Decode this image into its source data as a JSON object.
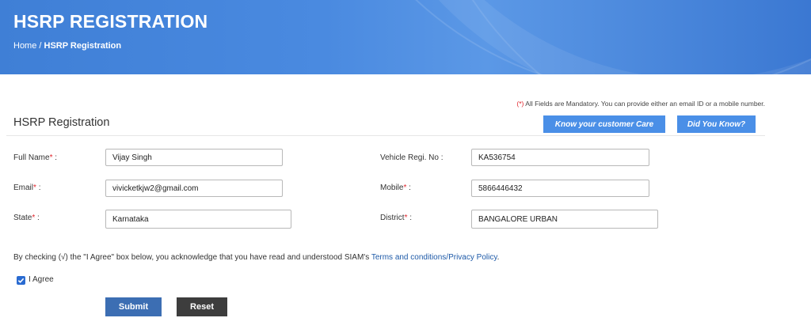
{
  "header": {
    "title": "HSRP REGISTRATION",
    "breadcrumb": {
      "home": "Home",
      "separator": " / ",
      "current": "HSRP Registration"
    }
  },
  "notice": {
    "marker": "(*)",
    "text": " All Fields are Mandatory. You can provide either an email ID or a mobile number."
  },
  "section": {
    "title": "HSRP Registration"
  },
  "buttons": {
    "customer_care": "Know your customer Care",
    "did_you_know": "Did You Know?",
    "submit": "Submit",
    "reset": "Reset"
  },
  "form": {
    "required_marker": "*",
    "full_name": {
      "label": "Full Name",
      "suffix": " :",
      "value": "Vijay Singh"
    },
    "vehicle_no": {
      "label": "Vehicle Regi. No :",
      "value": "KA536754"
    },
    "email": {
      "label": "Email",
      "suffix": " :",
      "value": "vivicketkjw2@gmail.com"
    },
    "mobile": {
      "label": "Mobile",
      "suffix": " :",
      "value": "5866446432"
    },
    "state": {
      "label": "State",
      "suffix": " :",
      "value": "Karnataka"
    },
    "district": {
      "label": "District",
      "suffix": " :",
      "value": "BANGALORE URBAN"
    }
  },
  "agreement": {
    "text": "By checking (√) the \"I Agree\" box below, you acknowledge that you have read and understood SIAM's ",
    "link": "Terms and conditions/Privacy Policy",
    "period": ".",
    "checkbox_label": "I Agree",
    "checked": true
  },
  "colors": {
    "banner": "#4a8ae0",
    "accent_button": "#4a8fe7",
    "submit": "#3c6eb3",
    "reset": "#3d3d3d",
    "required": "#e0242b",
    "link": "#1e5aa8"
  }
}
